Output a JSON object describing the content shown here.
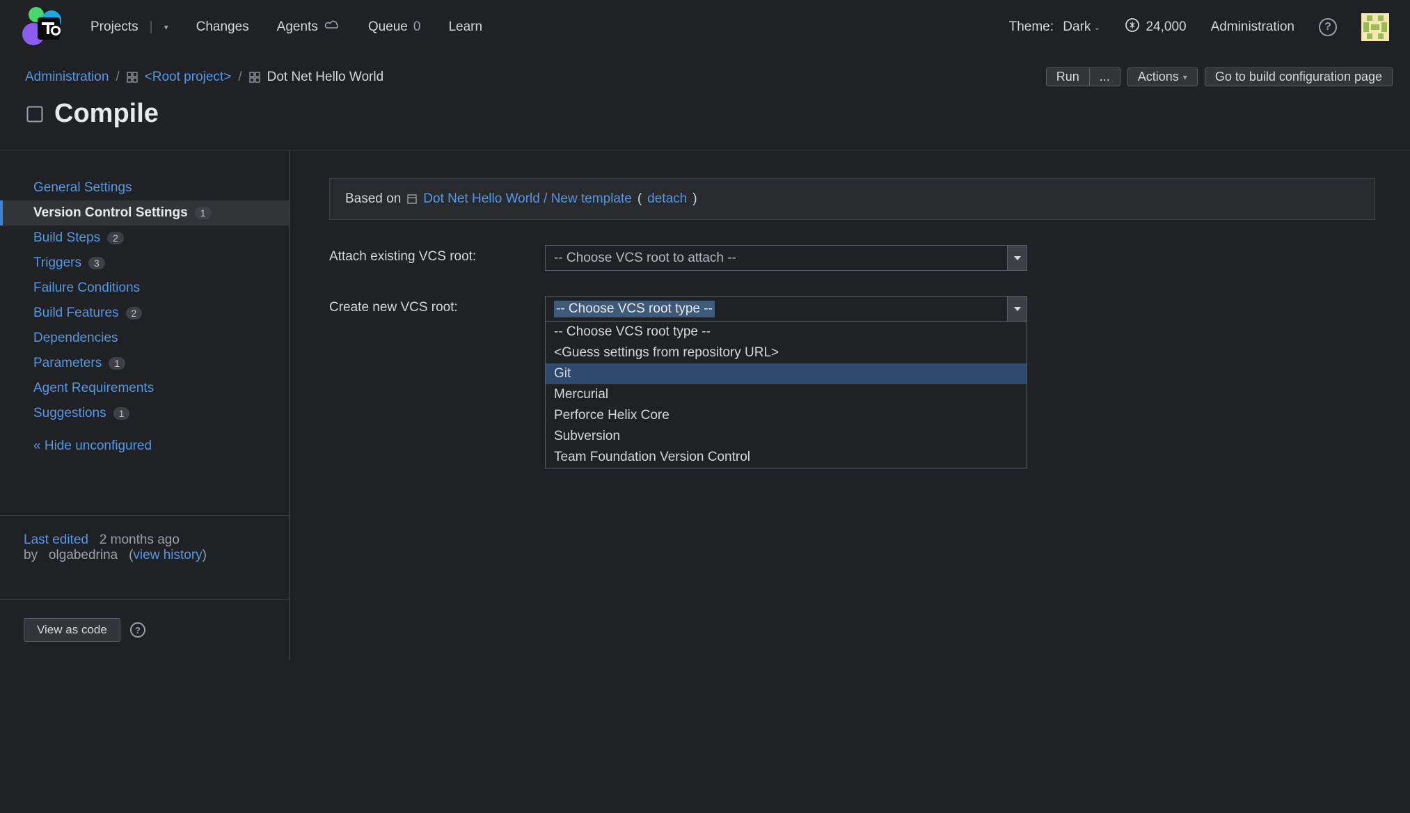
{
  "header": {
    "nav": {
      "projects": "Projects",
      "changes": "Changes",
      "agents": "Agents",
      "queue": "Queue",
      "queue_count": "0",
      "learn": "Learn"
    },
    "theme_label": "Theme:",
    "theme_value": "Dark",
    "coins": "24,000",
    "administration": "Administration"
  },
  "breadcrumb": {
    "administration": "Administration",
    "root_project": "<Root project>",
    "project": "Dot Net Hello World"
  },
  "actions": {
    "run": "Run",
    "run_more": "...",
    "actions": "Actions",
    "goto": "Go to build configuration page"
  },
  "page_title": "Compile",
  "sidebar": {
    "items": [
      {
        "label": "General Settings",
        "badge": null
      },
      {
        "label": "Version Control Settings",
        "badge": "1"
      },
      {
        "label": "Build Steps",
        "badge": "2"
      },
      {
        "label": "Triggers",
        "badge": "3"
      },
      {
        "label": "Failure Conditions",
        "badge": null
      },
      {
        "label": "Build Features",
        "badge": "2"
      },
      {
        "label": "Dependencies",
        "badge": null
      },
      {
        "label": "Parameters",
        "badge": "1"
      },
      {
        "label": "Agent Requirements",
        "badge": null
      },
      {
        "label": "Suggestions",
        "badge": "1"
      }
    ],
    "hide_unconfigured": "« Hide unconfigured"
  },
  "last_edited": {
    "prefix": "Last edited",
    "when": "2 months ago",
    "by_prefix": "by",
    "user": "olgabedrina",
    "view_history": "view history"
  },
  "view_as_code": "View as code",
  "template_banner": {
    "based_on": "Based on",
    "template_link": "Dot Net Hello World / New template",
    "detach": "detach"
  },
  "form": {
    "attach_label": "Attach existing VCS root:",
    "attach_value": "-- Choose VCS root to attach --",
    "create_label": "Create new VCS root:",
    "create_value": "-- Choose VCS root type --",
    "options": [
      "-- Choose VCS root type --",
      "<Guess settings from repository URL>",
      "Git",
      "Mercurial",
      "Perforce Helix Core",
      "Subversion",
      "Team Foundation Version Control"
    ]
  }
}
